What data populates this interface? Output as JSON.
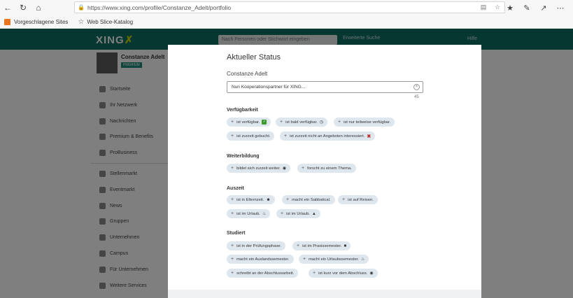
{
  "browser": {
    "url": "https://www.xing.com/profile/Constanze_Adelt/portfolio",
    "favorites": [
      {
        "label": "Vorgeschlagene Sites"
      },
      {
        "label": "Web Slice-Katalog"
      }
    ]
  },
  "xing": {
    "logo": "XING",
    "search_placeholder": "Nach Personen oder Stichwort eingeben",
    "search_extra": "Erweiterte Suche",
    "help": "Hilfe",
    "profile_name": "Constanze Adelt",
    "premium": "PREMIUM",
    "sidebar": [
      {
        "label": "Startseite"
      },
      {
        "label": "Ihr Netzwerk"
      },
      {
        "label": "Nachrichten"
      },
      {
        "label": "Premium & Benefits"
      },
      {
        "label": "ProBusiness"
      },
      {
        "label": "Stellenmarkt"
      },
      {
        "label": "Eventmarkt"
      },
      {
        "label": "News"
      },
      {
        "label": "Gruppen"
      },
      {
        "label": "Unternehmen"
      },
      {
        "label": "Campus"
      },
      {
        "label": "Für Unternehmen"
      },
      {
        "label": "Weitere Services"
      }
    ]
  },
  "modal": {
    "title": "Aktueller Status",
    "name": "Constanze Adelt",
    "input_value": "Nun Kooperationspartner für XING...",
    "char_count": "45",
    "sections": {
      "verfuegbarkeit": {
        "title": "Verfügbarkeit",
        "chips": [
          "ist verfügbar.",
          "ist bald verfügbar.",
          "ist nur teilweise verfügbar.",
          "ist zurzeit gebucht.",
          "ist zurzeit nicht an Angeboten interessiert."
        ]
      },
      "weiterbildung": {
        "title": "Weiterbildung",
        "chips": [
          "bildet sich zurzeit weiter.",
          "forscht zu einem Thema."
        ]
      },
      "auszeit": {
        "title": "Auszeit",
        "chips": [
          "ist in Elternzeit.",
          "macht ein Sabbatical.",
          "ist auf Reisen.",
          "ist im Urlaub.",
          "ist im Urlaub."
        ]
      },
      "studiert": {
        "title": "Studiert",
        "chips": [
          "ist in der Prüfungsphase.",
          "ist im Praxissemester.",
          "macht ein Auslandssemester.",
          "macht ein Urlaubssemester.",
          "schreibt an der Abschlussarbeit.",
          "ist kurz vor dem Abschluss."
        ]
      }
    }
  }
}
